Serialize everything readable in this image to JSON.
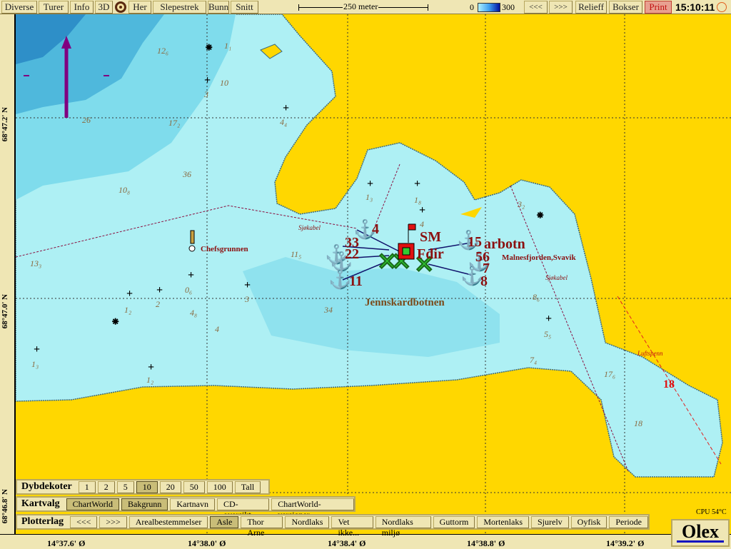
{
  "toolbar": {
    "buttons": [
      "Diverse",
      "Turer",
      "Info",
      "3D",
      "Her",
      "Slepestrek",
      "Bunn",
      "Snitt"
    ],
    "scale_label": "250 meter",
    "depth_min": "0",
    "depth_max": "300",
    "nav": [
      "<<<",
      ">>>"
    ],
    "relieff": "Relieff",
    "bokser": "Bokser",
    "print": "Print",
    "time": "15:10:11"
  },
  "rulers": {
    "lat": [
      "68°47.2' N",
      "68°47.0' N",
      "68°46.8' N"
    ],
    "lon": [
      "14°37.6' Ø",
      "14°38.0' Ø",
      "14°38.4' Ø",
      "14°38.8' Ø",
      "14°39.2' Ø"
    ]
  },
  "dybdekoter": {
    "title": "Dybdekoter",
    "options": [
      "1",
      "2",
      "5",
      "10",
      "20",
      "50",
      "100",
      "Tall"
    ],
    "selected": "10"
  },
  "kartvalg": {
    "title": "Kartvalg",
    "options": [
      "ChartWorld",
      "Bakgrunn",
      "Kartnavn",
      "CD-oversikt",
      "ChartWorld-versjoner"
    ],
    "selected": [
      "ChartWorld",
      "Bakgrunn"
    ]
  },
  "plotterlag": {
    "title": "Plotterlag",
    "options": [
      "<<<",
      ">>>",
      "Arealbestemmelser",
      "Asle",
      "Thor Arne",
      "Nordlaks",
      "Vet ikke...",
      "Nordlaks miljø",
      "Guttorm",
      "Mortenlaks",
      "Sjurelv",
      "Oyfisk",
      "Periode"
    ],
    "selected": "Asle"
  },
  "status": {
    "cpu": "CPU 54°C",
    "logo": "Olex"
  },
  "map": {
    "places": [
      "Chefsgrunnen",
      "Jennskardbotnen",
      "Malnesfjorden,Svavik",
      "Sjøkabel",
      "Sjøkabel",
      "Luftspenn",
      "SM",
      "Fdir",
      "arbotn"
    ],
    "depths": [
      "12₆",
      "1₁",
      "10",
      "3",
      "26",
      "17₂",
      "4₄",
      "36",
      "10₈",
      "1₈",
      "1₃",
      "4",
      "3₂",
      "13₃",
      "11₅",
      "0₆",
      "3",
      "1₂",
      "2",
      "4₈",
      "4",
      "34",
      "8₆",
      "5₅",
      "7₄",
      "17₆",
      "18",
      "1₃",
      "1₂"
    ],
    "marks": [
      "33",
      "22",
      "11",
      "4",
      "15",
      "7",
      "8",
      "56",
      "18"
    ],
    "colors": {
      "land": "#ffd700",
      "shallow": "#aef0f4",
      "mid": "#7fdcec",
      "deep": "#4fb8dc",
      "mark": "#8b1010"
    }
  }
}
